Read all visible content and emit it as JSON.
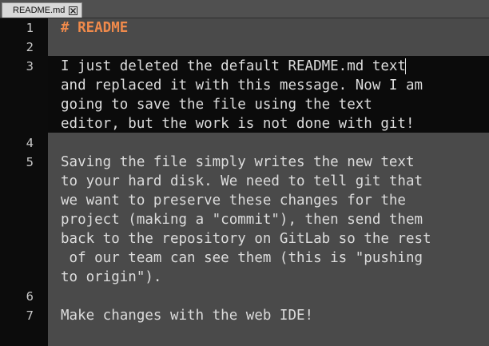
{
  "tab": {
    "label": "README.md",
    "close_icon": "close-icon"
  },
  "editor": {
    "lines": [
      {
        "number": "1",
        "text": [
          "# README"
        ]
      },
      {
        "number": "2",
        "text": [
          ""
        ]
      },
      {
        "number": "3",
        "text": [
          "I just deleted the default README.md text",
          "and replaced it with this message. Now I am",
          "going to save the file using the text",
          "editor, but the work is not done with git!"
        ]
      },
      {
        "number": "4",
        "text": [
          ""
        ]
      },
      {
        "number": "5",
        "text": [
          "Saving the file simply writes the new text",
          "to your hard disk. We need to tell git that",
          "we want to preserve these changes for the",
          "project (making a \"commit\"), then send them",
          "back to the repository on GitLab so the rest",
          " of our team can see them (this is \"pushing",
          "to origin\")."
        ]
      },
      {
        "number": "6",
        "text": [
          ""
        ]
      },
      {
        "number": "7",
        "text": [
          "Make changes with the web IDE!"
        ]
      }
    ]
  },
  "colors": {
    "heading": "#f08a4b",
    "text": "#dcdcdc",
    "background": "#4a4a4a",
    "current_line": "#0b0b0b",
    "gutter": "#0c0c0c"
  }
}
